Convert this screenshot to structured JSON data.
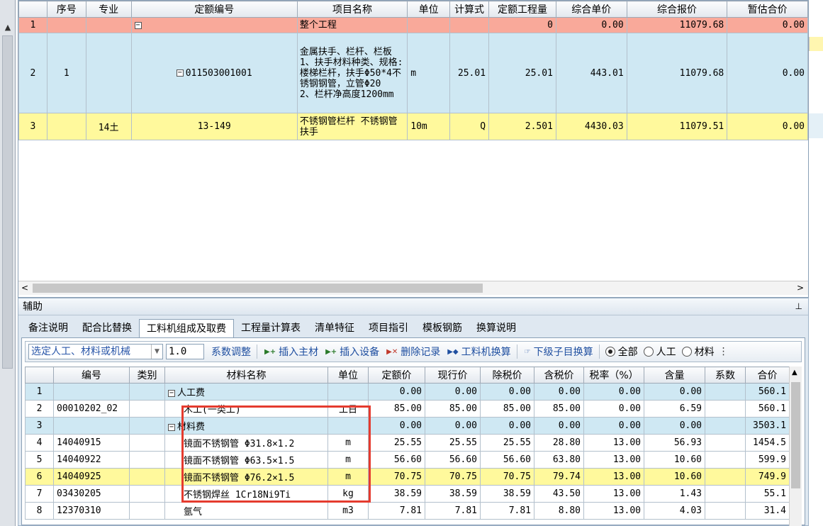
{
  "top_table": {
    "headers": [
      "",
      "序号",
      "专业",
      "定额编号",
      "项目名称",
      "单位",
      "计算式",
      "定额工程量",
      "综合单价",
      "综合报价",
      "暂估合价"
    ],
    "rows": [
      {
        "idx": "1",
        "seq": "",
        "major": "",
        "code": "",
        "name": "整个工程",
        "unit": "",
        "formula": "",
        "qty": "0",
        "price": "0.00",
        "total": "11079.68",
        "est": "0.00"
      },
      {
        "idx": "2",
        "seq": "1",
        "major": "",
        "code": "011503001001",
        "name": "金属扶手、栏杆、栏板\n1、扶手材料种类、规格:楼梯栏杆，扶手Φ50*4不锈钢钢管，立管Φ20\n2、栏杆净高度1200mm",
        "unit": "m",
        "formula": "25.01",
        "qty": "25.01",
        "price": "443.01",
        "total": "11079.68",
        "est": "0.00"
      },
      {
        "idx": "3",
        "seq": "",
        "major": "14土",
        "code": "13-149",
        "name": "不锈钢管栏杆 不锈钢管扶手",
        "unit": "10m",
        "formula": "Q",
        "qty": "2.501",
        "price": "4430.03",
        "total": "11079.51",
        "est": "0.00"
      }
    ]
  },
  "aux": {
    "title": "辅助",
    "tabs": [
      "备注说明",
      "配合比替换",
      "工料机组成及取费",
      "工程量计算表",
      "清单特征",
      "项目指引",
      "模板钢筋",
      "换算说明"
    ],
    "active_tab": 2,
    "toolbar": {
      "combo": "选定人工、材料或机械",
      "factor": "1.0",
      "adjust": "系数调整",
      "insert_main": "插入主材",
      "insert_equip": "插入设备",
      "delete": "删除记录",
      "convert": "工料机换算",
      "sub_convert": "下级子目换算",
      "radio_all": "全部",
      "radio_labor": "人工",
      "radio_material": "材料"
    }
  },
  "bottom_table": {
    "headers": [
      "",
      "编号",
      "类别",
      "材料名称",
      "单位",
      "定额价",
      "现行价",
      "除税价",
      "含税价",
      "税率（%）",
      "含量",
      "系数",
      "合价"
    ],
    "rows": [
      {
        "idx": "1",
        "code": "",
        "cat": "",
        "name": "人工费",
        "group": true,
        "unit": "",
        "base": "0.00",
        "cur": "0.00",
        "notax": "0.00",
        "tax": "0.00",
        "rate": "0.00",
        "amt": "0.00",
        "coef": "",
        "sum": "560.1"
      },
      {
        "idx": "2",
        "code": "00010202_02",
        "cat": "",
        "name": "木工(一类工)",
        "group": false,
        "unit": "工日",
        "base": "85.00",
        "cur": "85.00",
        "notax": "85.00",
        "tax": "85.00",
        "rate": "0.00",
        "amt": "6.59",
        "coef": "",
        "sum": "560.1"
      },
      {
        "idx": "3",
        "code": "",
        "cat": "",
        "name": "材料费",
        "group": true,
        "unit": "",
        "base": "0.00",
        "cur": "0.00",
        "notax": "0.00",
        "tax": "0.00",
        "rate": "0.00",
        "amt": "0.00",
        "coef": "",
        "sum": "3503.1"
      },
      {
        "idx": "4",
        "code": "14040915",
        "cat": "",
        "name": "镜面不锈钢管 Φ31.8×1.2",
        "group": false,
        "unit": "m",
        "base": "25.55",
        "cur": "25.55",
        "notax": "25.55",
        "tax": "28.80",
        "rate": "13.00",
        "amt": "56.93",
        "coef": "",
        "sum": "1454.5"
      },
      {
        "idx": "5",
        "code": "14040922",
        "cat": "",
        "name": "镜面不锈钢管 Φ63.5×1.5",
        "group": false,
        "unit": "m",
        "base": "56.60",
        "cur": "56.60",
        "notax": "56.60",
        "tax": "63.80",
        "rate": "13.00",
        "amt": "10.60",
        "coef": "",
        "sum": "599.9"
      },
      {
        "idx": "6",
        "code": "14040925",
        "cat": "",
        "name": "镜面不锈钢管 Φ76.2×1.5",
        "group": false,
        "unit": "m",
        "base": "70.75",
        "cur": "70.75",
        "notax": "70.75",
        "tax": "79.74",
        "rate": "13.00",
        "amt": "10.60",
        "coef": "",
        "sum": "749.9"
      },
      {
        "idx": "7",
        "code": "03430205",
        "cat": "",
        "name": "不锈钢焊丝 1Cr18Ni9Ti",
        "group": false,
        "unit": "kg",
        "base": "38.59",
        "cur": "38.59",
        "notax": "38.59",
        "tax": "43.50",
        "rate": "13.00",
        "amt": "1.43",
        "coef": "",
        "sum": "55.1"
      },
      {
        "idx": "8",
        "code": "12370310",
        "cat": "",
        "name": "氩气",
        "group": false,
        "unit": "m3",
        "base": "7.81",
        "cur": "7.81",
        "notax": "7.81",
        "tax": "8.80",
        "rate": "13.00",
        "amt": "4.03",
        "coef": "",
        "sum": "31.4"
      }
    ]
  },
  "colors": {
    "header_total_row": "#f9a99a",
    "selected_row": "#cfe8f3",
    "highlight_row": "#fff99c",
    "annotation_box": "#e53b2f"
  }
}
